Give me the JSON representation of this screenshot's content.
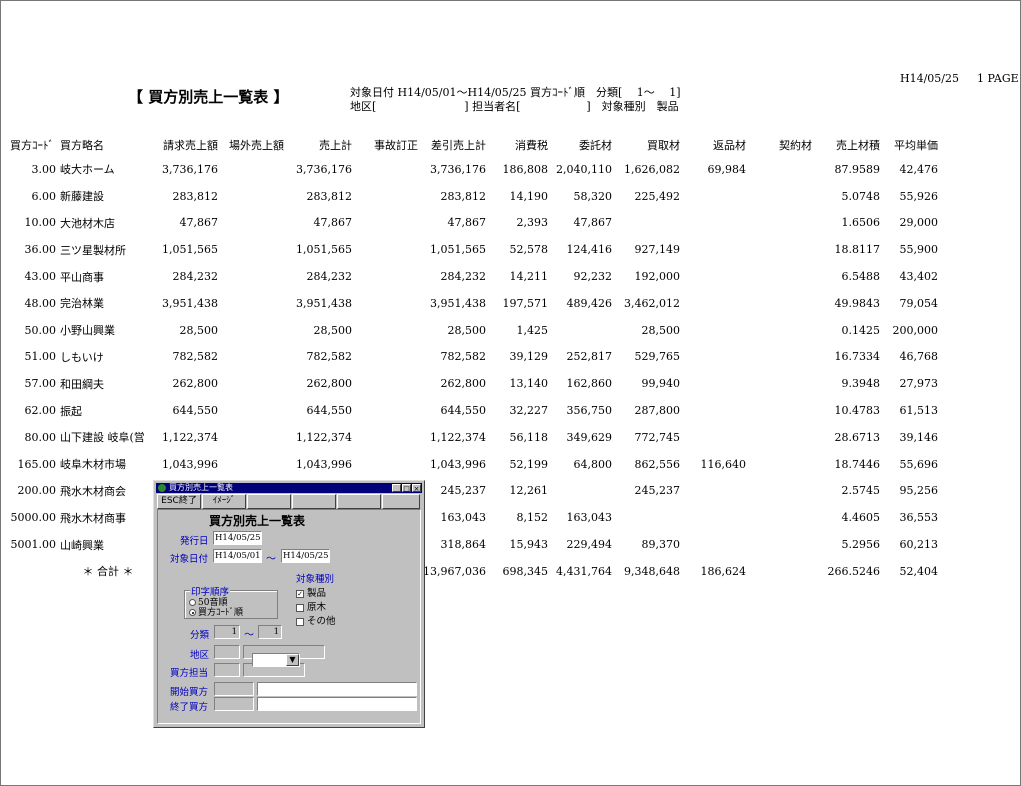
{
  "header": {
    "title": "【 買方別売上一覧表 】",
    "line1": "対象日付 H14/05/01～H14/05/25 買方ｺｰﾄﾞ順　分類[　 1～　 1]",
    "line2": "地区[　　　　　　　　] 担当者名[　　　　　　]　対象種別　製品",
    "date": "H14/05/25",
    "page": "1 PAGE"
  },
  "columns": [
    "買方ｺｰﾄﾞ",
    "買方略名",
    "請求売上額",
    "場外売上額",
    "売上計",
    "事故訂正",
    "差引売上計",
    "消費税",
    "委託材",
    "買取材",
    "返品材",
    "契約材",
    "売上材積",
    "平均単価"
  ],
  "rows": [
    [
      "3.00",
      "岐大ホーム",
      "3,736,176",
      "",
      "3,736,176",
      "",
      "3,736,176",
      "186,808",
      "2,040,110",
      "1,626,082",
      "69,984",
      "",
      "87.9589",
      "42,476"
    ],
    [
      "6.00",
      "新藤建設",
      "283,812",
      "",
      "283,812",
      "",
      "283,812",
      "14,190",
      "58,320",
      "225,492",
      "",
      "",
      "5.0748",
      "55,926"
    ],
    [
      "10.00",
      "大池材木店",
      "47,867",
      "",
      "47,867",
      "",
      "47,867",
      "2,393",
      "47,867",
      "",
      "",
      "",
      "1.6506",
      "29,000"
    ],
    [
      "36.00",
      "三ツ星製材所",
      "1,051,565",
      "",
      "1,051,565",
      "",
      "1,051,565",
      "52,578",
      "124,416",
      "927,149",
      "",
      "",
      "18.8117",
      "55,900"
    ],
    [
      "43.00",
      "平山商事",
      "284,232",
      "",
      "284,232",
      "",
      "284,232",
      "14,211",
      "92,232",
      "192,000",
      "",
      "",
      "6.5488",
      "43,402"
    ],
    [
      "48.00",
      "完治林業",
      "3,951,438",
      "",
      "3,951,438",
      "",
      "3,951,438",
      "197,571",
      "489,426",
      "3,462,012",
      "",
      "",
      "49.9843",
      "79,054"
    ],
    [
      "50.00",
      "小野山興業",
      "28,500",
      "",
      "28,500",
      "",
      "28,500",
      "1,425",
      "",
      "28,500",
      "",
      "",
      "0.1425",
      "200,000"
    ],
    [
      "51.00",
      "しもいけ",
      "782,582",
      "",
      "782,582",
      "",
      "782,582",
      "39,129",
      "252,817",
      "529,765",
      "",
      "",
      "16.7334",
      "46,768"
    ],
    [
      "57.00",
      "和田綱夫",
      "262,800",
      "",
      "262,800",
      "",
      "262,800",
      "13,140",
      "162,860",
      "99,940",
      "",
      "",
      "9.3948",
      "27,973"
    ],
    [
      "62.00",
      "振起",
      "644,550",
      "",
      "644,550",
      "",
      "644,550",
      "32,227",
      "356,750",
      "287,800",
      "",
      "",
      "10.4783",
      "61,513"
    ],
    [
      "80.00",
      "山下建設 岐阜(営",
      "1,122,374",
      "",
      "1,122,374",
      "",
      "1,122,374",
      "56,118",
      "349,629",
      "772,745",
      "",
      "",
      "28.6713",
      "39,146"
    ],
    [
      "165.00",
      "岐阜木材市場",
      "1,043,996",
      "",
      "1,043,996",
      "",
      "1,043,996",
      "52,199",
      "64,800",
      "862,556",
      "116,640",
      "",
      "18.7446",
      "55,696"
    ],
    [
      "200.00",
      "飛水木材商会",
      "",
      "",
      "",
      "",
      "245,237",
      "12,261",
      "",
      "245,237",
      "",
      "",
      "2.5745",
      "95,256"
    ],
    [
      "5000.00",
      "飛水木材商事",
      "",
      "",
      "",
      "",
      "163,043",
      "8,152",
      "163,043",
      "",
      "",
      "",
      "4.4605",
      "36,553"
    ],
    [
      "5001.00",
      "山崎興業",
      "",
      "",
      "",
      "",
      "318,864",
      "15,943",
      "229,494",
      "89,370",
      "",
      "",
      "5.2956",
      "60,213"
    ],
    [
      "",
      "＊ 合計 ＊",
      "",
      "",
      "",
      "",
      "13,967,036",
      "698,345",
      "4,431,764",
      "9,348,648",
      "186,624",
      "",
      "266.5246",
      "52,404"
    ]
  ],
  "dialog": {
    "window_title": "買方別売上一覧表",
    "btn_esc": "ESC終了",
    "btn_image": "ｲﾒｰｼﾞ",
    "heading": "買方別売上一覧表",
    "label_issue_date": "発行日",
    "issue_date": "H14/05/25",
    "label_target_date": "対象日付",
    "date_from": "H14/05/01",
    "tilde": "～",
    "date_to": "H14/05/25",
    "print_order_title": "印字順序",
    "order_opt1": "50音順",
    "order_opt2": "買方ｺｰﾄﾞ順",
    "target_type_title": "対象種別",
    "chk_product": "製品",
    "chk_raw": "原木",
    "chk_other": "その他",
    "checkmark": "✓",
    "label_class": "分類",
    "class_from": "1",
    "class_to": "1",
    "label_area": "地区",
    "label_buyer_staff": "買方担当",
    "label_start_buyer": "開始買方",
    "label_end_buyer": "終了買方",
    "min_glyph": "_",
    "max_glyph": "□",
    "close_glyph": "×",
    "dropdown_glyph": "▼"
  }
}
